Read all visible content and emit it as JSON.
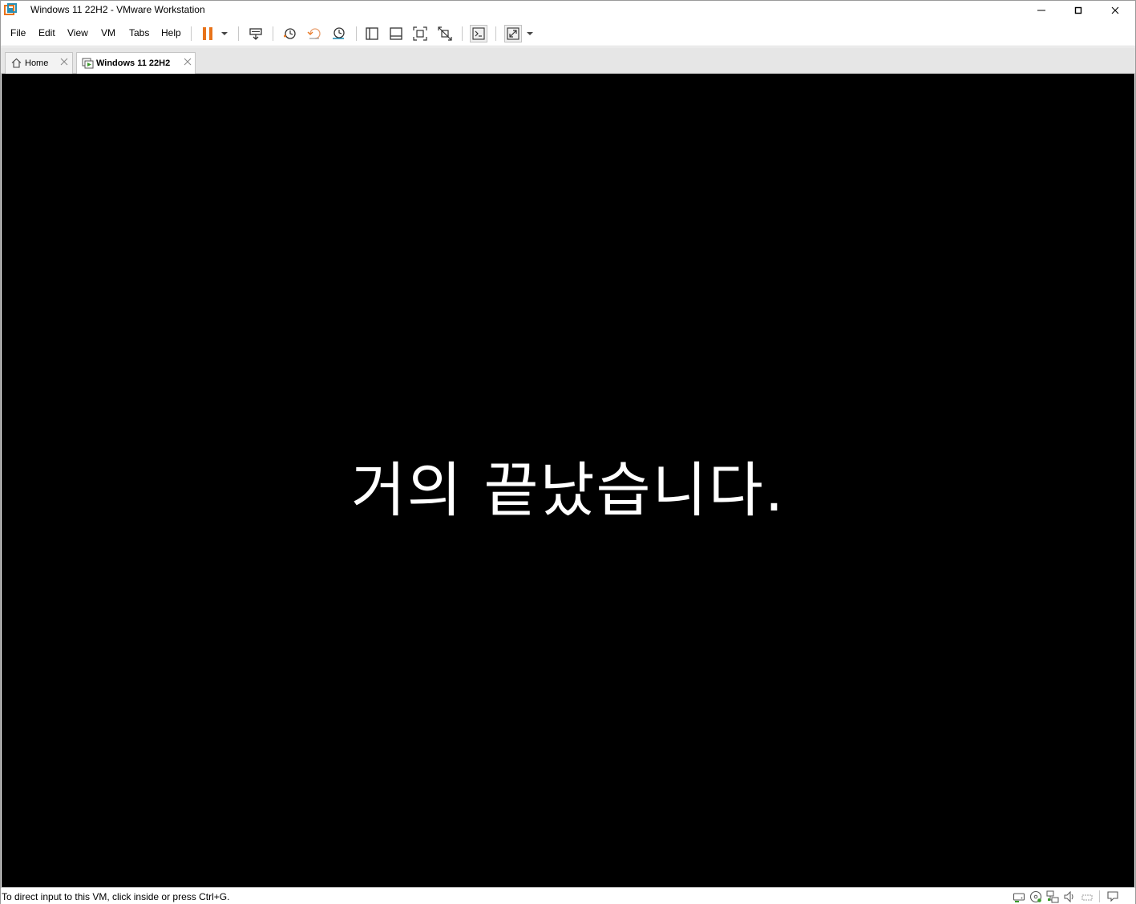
{
  "window": {
    "title": "Windows 11 22H2 - VMware Workstation",
    "accent_orange": "#e8731a",
    "accent_teal": "#2a8fb5"
  },
  "menu": {
    "items": [
      "File",
      "Edit",
      "View",
      "VM",
      "Tabs",
      "Help"
    ]
  },
  "toolbar": {
    "icons": [
      "pause-icon",
      "dropdown-arrow-icon",
      "send-ctrl-alt-del-icon",
      "snapshot-take-icon",
      "snapshot-revert-icon",
      "snapshot-manager-icon",
      "library-view-icon",
      "thumbnail-view-icon",
      "full-screen-icon",
      "unity-icon",
      "console-view-icon",
      "stretch-guest-icon",
      "dropdown-arrow-icon"
    ]
  },
  "tabs": [
    {
      "label": "Home",
      "icon": "home-icon",
      "active": false
    },
    {
      "label": "Windows 11 22H2",
      "icon": "vm-icon",
      "active": true
    }
  ],
  "console": {
    "message": "거의 끝났습니다."
  },
  "statusbar": {
    "text": "To direct input to this VM, click inside or press Ctrl+G.",
    "icons": [
      "hard-disk-icon",
      "cd-dvd-icon",
      "network-icon",
      "sound-icon",
      "printer-icon",
      "message-log-icon"
    ]
  }
}
